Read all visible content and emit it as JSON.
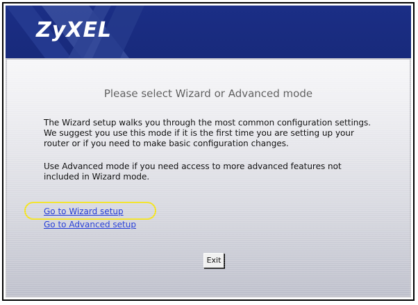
{
  "header": {
    "logo_text": "ZyXEL",
    "logo_name": "zyxel-logo",
    "background_color": "#1b2e86",
    "stripe_color": "#3a4f9e"
  },
  "main": {
    "title": "Please select Wizard or Advanced mode",
    "paragraph1_lines": [
      "The Wizard setup walks you through the most common configuration settings.",
      "We suggest you use this mode if it is the first time you are setting up your",
      "router or if you need to make basic configuration changes."
    ],
    "paragraph2_lines": [
      "Use Advanced mode if you need access to more advanced features not",
      "included in Wizard mode."
    ],
    "link_wizard": "Go to Wizard setup",
    "link_advanced": "Go to Advanced setup",
    "exit_label": "Exit",
    "link_color": "#1a33d6",
    "highlight_color": "#f3e21a"
  }
}
